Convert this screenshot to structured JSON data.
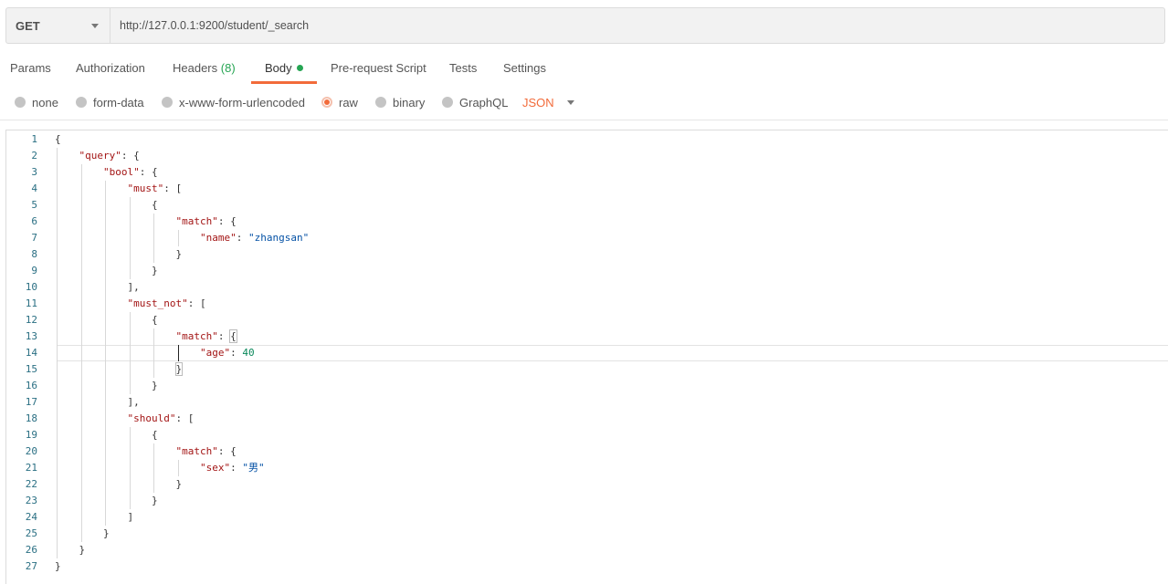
{
  "request": {
    "method": "GET",
    "url": "http://127.0.0.1:9200/student/_search"
  },
  "tabs": [
    {
      "label": "Params",
      "count": ""
    },
    {
      "label": "Authorization",
      "count": ""
    },
    {
      "label": "Headers",
      "count": "(8)"
    },
    {
      "label": "Body",
      "count": ""
    },
    {
      "label": "Pre-request Script",
      "count": ""
    },
    {
      "label": "Tests",
      "count": ""
    },
    {
      "label": "Settings",
      "count": ""
    }
  ],
  "active_tab": "Body",
  "body_types": [
    "none",
    "form-data",
    "x-www-form-urlencoded",
    "raw",
    "binary",
    "GraphQL"
  ],
  "selected_body_type": "raw",
  "format": "JSON",
  "icons": {
    "method_dropdown": "chevron-down-icon",
    "format_dropdown": "chevron-down-icon",
    "body_modified": "dot-icon"
  },
  "colors": {
    "accent": "#f26b3a",
    "count": "#26a553",
    "line_number": "#2a6f83",
    "json_key": "#a31515",
    "json_string": "#0451a5",
    "json_number": "#09885a"
  },
  "editor": {
    "lines": [
      {
        "n": "1",
        "indent": 0,
        "tokens": [
          [
            "p",
            "{"
          ]
        ]
      },
      {
        "n": "2",
        "indent": 1,
        "tokens": [
          [
            "k",
            "\"query\""
          ],
          [
            "p",
            ": {"
          ]
        ]
      },
      {
        "n": "3",
        "indent": 2,
        "tokens": [
          [
            "k",
            "\"bool\""
          ],
          [
            "p",
            ": {"
          ]
        ]
      },
      {
        "n": "4",
        "indent": 3,
        "tokens": [
          [
            "k",
            "\"must\""
          ],
          [
            "p",
            ": ["
          ]
        ]
      },
      {
        "n": "5",
        "indent": 4,
        "tokens": [
          [
            "p",
            "{"
          ]
        ]
      },
      {
        "n": "6",
        "indent": 5,
        "tokens": [
          [
            "k",
            "\"match\""
          ],
          [
            "p",
            ": {"
          ]
        ]
      },
      {
        "n": "7",
        "indent": 6,
        "tokens": [
          [
            "k",
            "\"name\""
          ],
          [
            "p",
            ": "
          ],
          [
            "s",
            "\"zhangsan\""
          ]
        ]
      },
      {
        "n": "8",
        "indent": 5,
        "tokens": [
          [
            "p",
            "}"
          ]
        ]
      },
      {
        "n": "9",
        "indent": 4,
        "tokens": [
          [
            "p",
            "}"
          ]
        ]
      },
      {
        "n": "10",
        "indent": 3,
        "tokens": [
          [
            "p",
            "],"
          ]
        ]
      },
      {
        "n": "11",
        "indent": 3,
        "tokens": [
          [
            "k",
            "\"must_not\""
          ],
          [
            "p",
            ": ["
          ]
        ]
      },
      {
        "n": "12",
        "indent": 4,
        "tokens": [
          [
            "p",
            "{"
          ]
        ]
      },
      {
        "n": "13",
        "indent": 5,
        "tokens": [
          [
            "k",
            "\"match\""
          ],
          [
            "p",
            ": "
          ],
          [
            "b",
            "{"
          ]
        ]
      },
      {
        "n": "14",
        "indent": 6,
        "tokens": [
          [
            "k",
            "\"age\""
          ],
          [
            "p",
            ": "
          ],
          [
            "n",
            "40"
          ]
        ]
      },
      {
        "n": "15",
        "indent": 5,
        "tokens": [
          [
            "b",
            "}"
          ]
        ]
      },
      {
        "n": "16",
        "indent": 4,
        "tokens": [
          [
            "p",
            "}"
          ]
        ]
      },
      {
        "n": "17",
        "indent": 3,
        "tokens": [
          [
            "p",
            "],"
          ]
        ]
      },
      {
        "n": "18",
        "indent": 3,
        "tokens": [
          [
            "k",
            "\"should\""
          ],
          [
            "p",
            ": ["
          ]
        ]
      },
      {
        "n": "19",
        "indent": 4,
        "tokens": [
          [
            "p",
            "{"
          ]
        ]
      },
      {
        "n": "20",
        "indent": 5,
        "tokens": [
          [
            "k",
            "\"match\""
          ],
          [
            "p",
            ": {"
          ]
        ]
      },
      {
        "n": "21",
        "indent": 6,
        "tokens": [
          [
            "k",
            "\"sex\""
          ],
          [
            "p",
            ": "
          ],
          [
            "s",
            "\"男\""
          ]
        ]
      },
      {
        "n": "22",
        "indent": 5,
        "tokens": [
          [
            "p",
            "}"
          ]
        ]
      },
      {
        "n": "23",
        "indent": 4,
        "tokens": [
          [
            "p",
            "}"
          ]
        ]
      },
      {
        "n": "24",
        "indent": 3,
        "tokens": [
          [
            "p",
            "]"
          ]
        ]
      },
      {
        "n": "25",
        "indent": 2,
        "tokens": [
          [
            "p",
            "}"
          ]
        ]
      },
      {
        "n": "26",
        "indent": 1,
        "tokens": [
          [
            "p",
            "}"
          ]
        ]
      },
      {
        "n": "27",
        "indent": 0,
        "tokens": [
          [
            "p",
            "}"
          ]
        ]
      }
    ],
    "current_line": "14"
  }
}
